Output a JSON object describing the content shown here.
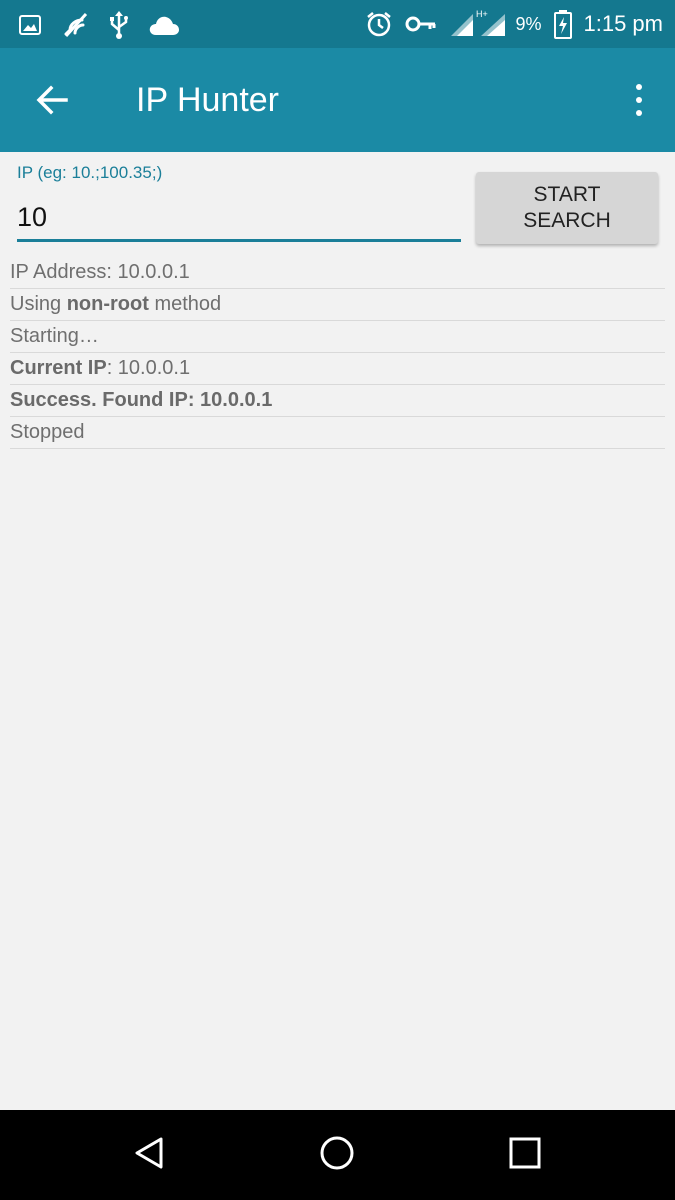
{
  "status_bar": {
    "battery_percent": "9%",
    "time": "1:15 pm",
    "network_label": "H+",
    "icons_left": [
      "image-icon",
      "no-signal-icon",
      "usb-icon",
      "cloud-icon"
    ],
    "icons_right": [
      "alarm-icon",
      "key-icon",
      "signal-icon",
      "battery-icon"
    ]
  },
  "app_bar": {
    "title": "IP Hunter",
    "back_icon": "arrow-left-icon",
    "menu_icon": "more-vert-icon"
  },
  "form": {
    "ip_label": "IP (eg: 10.;100.35;)",
    "ip_value": "10",
    "start_button_label": "START SEARCH"
  },
  "log": [
    {
      "parts": [
        {
          "text": "IP Address: 10.0.0.1",
          "bold": false
        }
      ]
    },
    {
      "parts": [
        {
          "text": "Using ",
          "bold": false
        },
        {
          "text": "non-root",
          "bold": true
        },
        {
          "text": " method",
          "bold": false
        }
      ]
    },
    {
      "parts": [
        {
          "text": "Starting…",
          "bold": false
        }
      ]
    },
    {
      "parts": [
        {
          "text": "Current IP",
          "bold": true
        },
        {
          "text": ": 10.0.0.1",
          "bold": false
        }
      ]
    },
    {
      "parts": [
        {
          "text": "Success. Found IP: 10.0.0.1",
          "bold": true
        }
      ]
    },
    {
      "parts": [
        {
          "text": "Stopped",
          "bold": false
        }
      ]
    }
  ],
  "nav_bar": {
    "buttons": [
      "back-triangle-icon",
      "home-circle-icon",
      "recents-square-icon"
    ]
  },
  "colors": {
    "status_bar": "#14788f",
    "app_bar": "#1b8aa5",
    "accent": "#1b7f99",
    "background": "#f2f2f2"
  }
}
